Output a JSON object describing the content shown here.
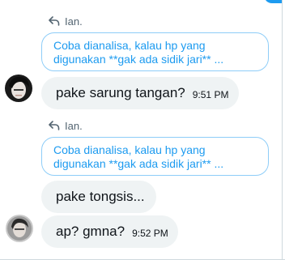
{
  "thread": {
    "groups": [
      {
        "reply_to": "Ian.",
        "quoted_lines": [
          "Coba dianalisa, kalau hp yang",
          "digunakan **gak ada sidik jari** ..."
        ],
        "message": {
          "text": "pake sarung tangan?",
          "time": "9:51 PM"
        }
      },
      {
        "reply_to": "Ian.",
        "quoted_lines": [
          "Coba dianalisa, kalau hp yang",
          "digunakan **gak ada sidik jari** ..."
        ],
        "messages": [
          {
            "text": "pake tongsis..."
          },
          {
            "text": "ap? gmna?",
            "time": "9:52 PM"
          }
        ]
      }
    ]
  },
  "icons": {
    "reply": "reply-arrow-icon",
    "avatar": "user-avatar"
  },
  "colors": {
    "accent": "#1d9bf0",
    "quote_border": "#8ecdf8",
    "bubble_bg": "#eff3f4",
    "muted_text": "#536471"
  }
}
